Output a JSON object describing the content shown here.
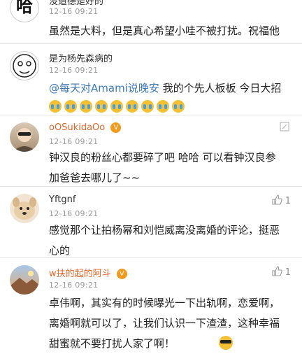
{
  "comments": [
    {
      "username": "没道德是好的",
      "time": "12-16 09:21",
      "avatar_text": "哈",
      "text": "虽然是大料，但是真心希望小哇不被打扰。祝福他"
    },
    {
      "username": "是为杨先森病的",
      "time": "12-16 09:21",
      "mention": "@每天对Amami说晚安",
      "text": "我的个先人板板 今日大招",
      "emoji_count": 9
    },
    {
      "username": "oOSukidaOo",
      "time": "12-16 09:21",
      "text_line1": "钟汉良的粉丝心都要碎了吧 哈哈 可以看钟汉良参",
      "text_line2": "加爸爸去哪儿了~~"
    },
    {
      "username": "Yftgnf",
      "time": "12-16 09:21",
      "likes": "1",
      "text_line1": "感觉那个让拍杨幂和刘恺威离没离婚的评论，挺恶",
      "text_line2": "心的"
    },
    {
      "username": "w扶的起的阿斗",
      "time": "12-16 09:21",
      "likes": "1",
      "text_line1": "卓伟啊，其实有的时候曝光一下出轨啊，恋爱啊，",
      "text_line2": "离婚啊就可以了，让我们认识一下渣渣，这种幸福",
      "text_line3": "甜蜜就不要打扰人家了啊！"
    }
  ],
  "badge_text": "V",
  "colors": {
    "orange_username": "#e2662a",
    "mention": "#3c79b8",
    "badge": "#f39a1c"
  }
}
